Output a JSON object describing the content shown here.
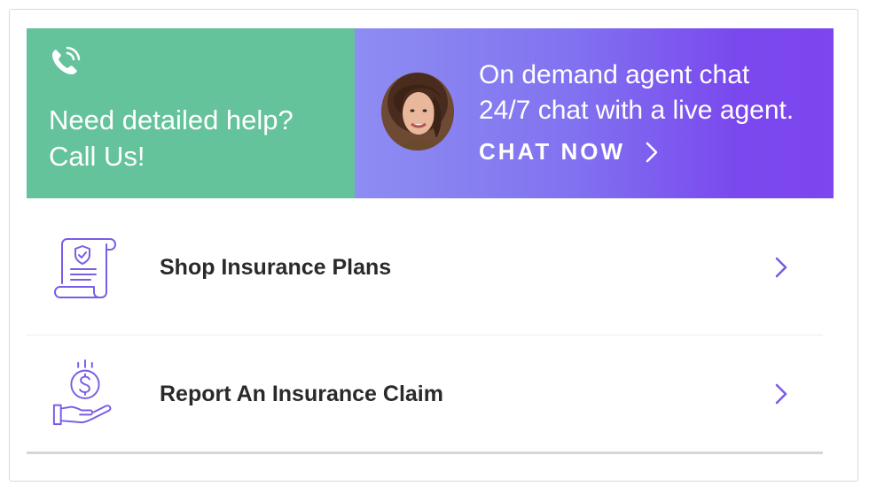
{
  "call_panel": {
    "line1": "Need detailed help?",
    "line2": "Call Us!",
    "icon": "phone-icon",
    "bg_color": "#64c39a"
  },
  "chat_panel": {
    "title": "On demand agent chat",
    "subtitle": "24/7 chat with a live agent.",
    "cta_label": "CHAT NOW",
    "cta_icon": "chevron-right-icon",
    "gradient_start": "#8e8df2",
    "gradient_end": "#7d46ef"
  },
  "menu": {
    "items": [
      {
        "label": "Shop Insurance Plans",
        "icon": "insurance-policy-icon"
      },
      {
        "label": "Report An Insurance Claim",
        "icon": "money-hand-icon"
      }
    ],
    "accent_color": "#7b5ce6"
  }
}
